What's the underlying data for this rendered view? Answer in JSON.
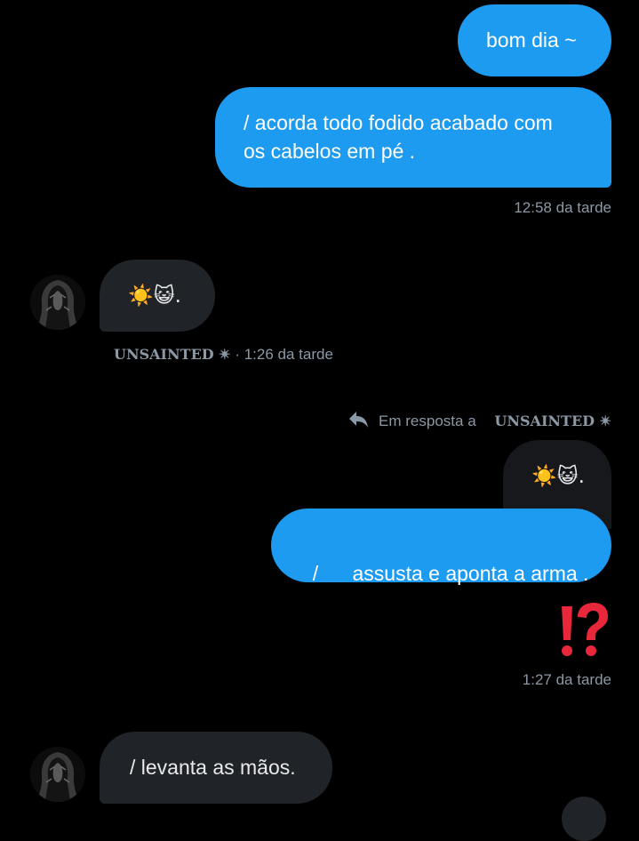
{
  "messages": {
    "m1": "bom dia ~",
    "m2_line1": "/ acorda todo fodido acabado com",
    "m2_line2": "os cabelos em pé .",
    "time1": "12:58 da tarde",
    "m3": "☀️😺.",
    "sender_name": "UNSAINTED ✴",
    "sender_time": "· 1:26 da tarde",
    "reply_label": "Em resposta a",
    "reply_target": "UNSAINTED ✴",
    "quoted": "☀️😺.",
    "m4": "/      assusta e aponta a arma .",
    "m5": "⁉️",
    "time2": "1:27 da tarde",
    "m6": "/ levanta as mãos."
  },
  "colors": {
    "background": "#000000",
    "outgoing_bubble": "#1d9bf0",
    "incoming_bubble": "#202327",
    "meta_text": "#8b98a5",
    "reaction_red": "#e8283a"
  },
  "icons": {
    "reply": "reply-arrow-icon",
    "avatar": "hooded-figure-avatar"
  }
}
